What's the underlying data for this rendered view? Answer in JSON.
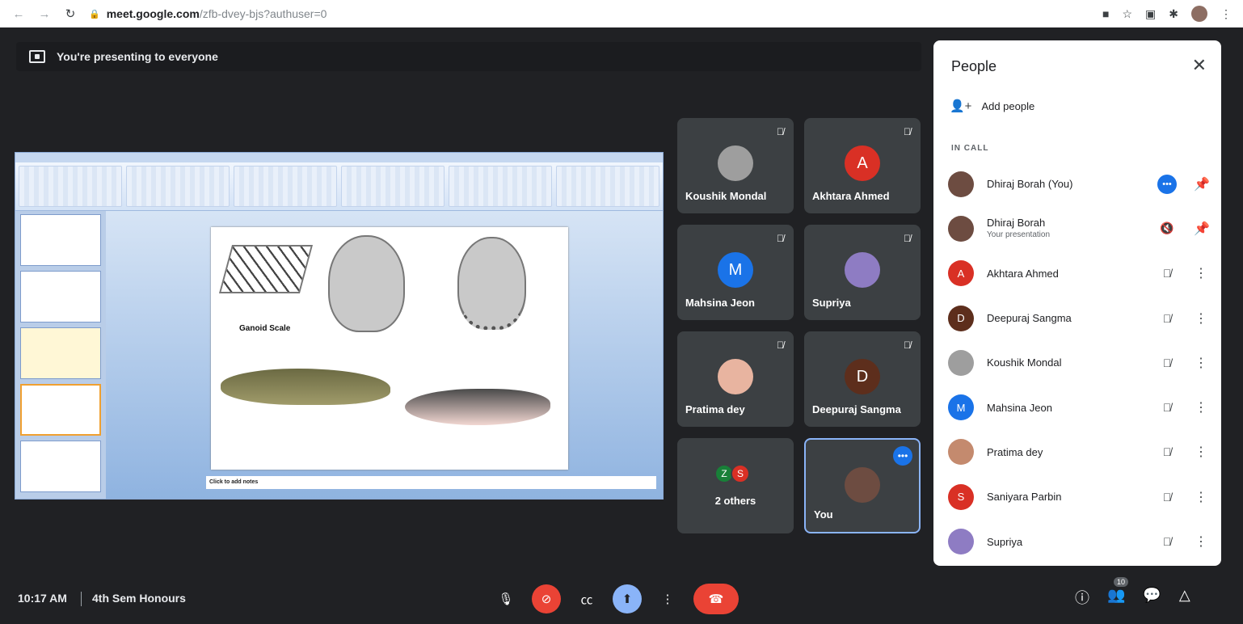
{
  "browser": {
    "url_host": "meet.google.com",
    "url_path": "/zfb-dvey-bjs?authuser=0"
  },
  "banner": {
    "text": "You're presenting to everyone"
  },
  "slide": {
    "label": "Ganoid Scale",
    "notes_placeholder": "Click to add notes"
  },
  "tiles": [
    {
      "name": "Koushik Mondal",
      "avatar_color": "#9e9e9e",
      "initial": ""
    },
    {
      "name": "Akhtara Ahmed",
      "avatar_color": "#d93025",
      "initial": "A"
    },
    {
      "name": "Mahsina Jeon",
      "avatar_color": "#1a73e8",
      "initial": "M"
    },
    {
      "name": "Supriya",
      "avatar_color": "#8e7cc3",
      "initial": ""
    },
    {
      "name": "Pratima dey",
      "avatar_color": "#e8b4a0",
      "initial": ""
    },
    {
      "name": "Deepuraj Sangma",
      "avatar_color": "#5d2e1c",
      "initial": "D"
    }
  ],
  "others_tile": {
    "label": "2 others",
    "initials": [
      "Z",
      "S"
    ],
    "colors": [
      "#188038",
      "#d93025"
    ]
  },
  "you_tile": {
    "name": "You"
  },
  "people_panel": {
    "title": "People",
    "add_people": "Add people",
    "section": "IN CALL",
    "participants": [
      {
        "name": "Dhiraj Borah (You)",
        "sub": "",
        "initial": "",
        "color": "#6d4c41"
      },
      {
        "name": "Dhiraj Borah",
        "sub": "Your presentation",
        "initial": "",
        "color": "#6d4c41"
      },
      {
        "name": "Akhtara Ahmed",
        "sub": "",
        "initial": "A",
        "color": "#d93025"
      },
      {
        "name": "Deepuraj Sangma",
        "sub": "",
        "initial": "D",
        "color": "#5d2e1c"
      },
      {
        "name": "Koushik Mondal",
        "sub": "",
        "initial": "",
        "color": "#9e9e9e"
      },
      {
        "name": "Mahsina Jeon",
        "sub": "",
        "initial": "M",
        "color": "#1a73e8"
      },
      {
        "name": "Pratima dey",
        "sub": "",
        "initial": "",
        "color": "#c48a6e"
      },
      {
        "name": "Saniyara Parbin",
        "sub": "",
        "initial": "S",
        "color": "#d93025"
      },
      {
        "name": "Supriya",
        "sub": "",
        "initial": "",
        "color": "#8e7cc3"
      }
    ]
  },
  "bottom_bar": {
    "time": "10:17 AM",
    "meeting_name": "4th Sem Honours",
    "participant_count": "10"
  }
}
